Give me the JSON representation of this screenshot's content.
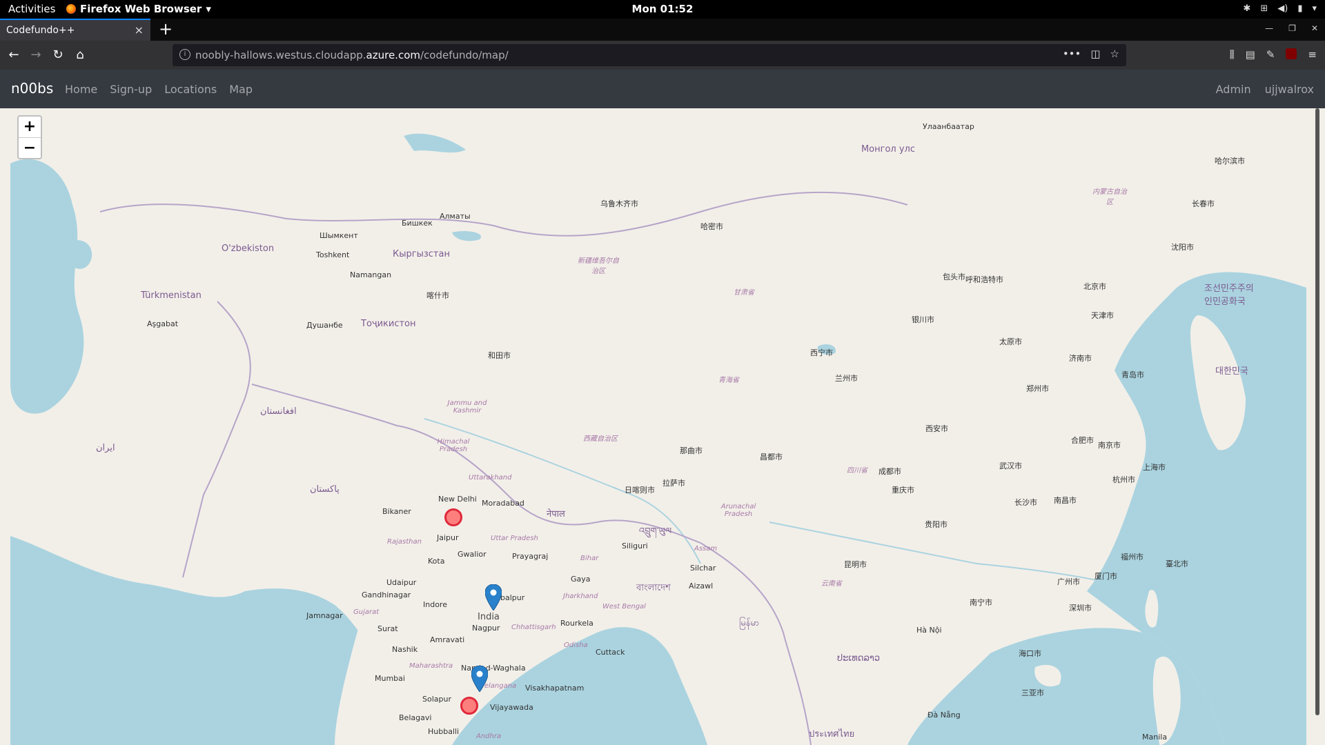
{
  "os_panel": {
    "activities": "Activities",
    "app_name": "Firefox Web Browser",
    "clock": "Mon 01:52"
  },
  "browser": {
    "tab_title": "Codefundo++",
    "url_prefix": "noobly-hallows.westus.cloudapp.",
    "url_host": "azure.com",
    "url_path": "/codefundo/map/"
  },
  "site_nav": {
    "brand": "n00bs",
    "links": [
      "Home",
      "Sign-up",
      "Locations",
      "Map"
    ],
    "right_links": [
      "Admin",
      "ujjwalrox"
    ]
  },
  "map": {
    "zoom_in": "+",
    "zoom_out": "−",
    "labels": {
      "new_delhi": "New Delhi",
      "moradabad": "Moradabad",
      "jaipur": "Jaipur",
      "bikaner": "Bikaner",
      "gwalior": "Gwalior",
      "kota": "Kota",
      "prayagraj": "Prayagraj",
      "udaipur": "Udaipur",
      "gandhinagar": "Gandhinagar",
      "indore": "Indore",
      "jabalpur": "Jabalpur",
      "india": "India",
      "nagpur": "Nagpur",
      "surat": "Surat",
      "amravati": "Amravati",
      "nashik": "Nashik",
      "mumbai": "Mumbai",
      "nanded": "Nanded-Waghala",
      "solapur": "Solapur",
      "vijayawada": "Vijayawada",
      "visakhapatnam": "Visakhapatnam",
      "belagavi": "Belagavi",
      "hubballi": "Hubballi",
      "cuttack": "Cuttack",
      "rourkela": "Rourkela",
      "gaya": "Gaya",
      "siliguri": "Siliguri",
      "silchar": "Silchar",
      "aizawl": "Aizawl",
      "jamnagar": "Jamnagar",
      "da_nang": "Đà Nẵng",
      "ha_noi": "Hà Nội",
      "manila": "Manila",
      "mongol": "Монгол улс",
      "ulaanbaatar": "Улаанбаатар",
      "bishkek": "Бишкек",
      "almaty": "Алматы",
      "tashkent": "Toshkent",
      "uzbekistan": "O'zbekiston",
      "turkmenistan": "Türkmenistan",
      "kyrgyzstan": "Кыргызстан",
      "tajikistan": "Тоҷикистон",
      "dushanbe": "Душанбе",
      "shymkent": "Шымкент",
      "namangan": "Namangan",
      "ashgabat": "Aşgabat",
      "urumqi": "乌鲁木齐市",
      "hami": "哈密市",
      "kashgar": "喀什市",
      "hotan": "和田市",
      "lhasa": "拉萨市",
      "shigatse": "日喀则市",
      "nagqu": "那曲市",
      "qamdo": "昌都市",
      "chengdu": "成都市",
      "chongqing": "重庆市",
      "wuhan": "武汉市",
      "beijing": "北京市",
      "tianjin": "天津市",
      "shanghai": "上海市",
      "xian": "西安市",
      "lanzhou": "兰州市",
      "xining": "西宁市",
      "kunming": "昆明市",
      "guiyang": "贵阳市",
      "nanning": "南宁市",
      "guangzhou": "广州市",
      "hangzhou": "杭州市",
      "nanjing": "南京市",
      "qingdao": "青岛市",
      "shenyang": "沈阳市",
      "changchun": "长春市",
      "harbin": "哈尔滨市",
      "hohhot": "呼和浩特市",
      "baotou": "包头市",
      "yinchuan": "银川市",
      "zhengzhou": "郑州市",
      "taiyuan": "太原市",
      "jinan": "济南市",
      "hefei": "合肥市",
      "nanchang": "南昌市",
      "changsha": "长沙市",
      "fuzhou": "福州市",
      "xiamen": "厦门市",
      "shenzhen": "深圳市",
      "taipei": "臺北市",
      "haikou": "海口市",
      "sanya": "三亚市",
      "korea": "대한민국",
      "dprk": "조선민주주의인민공화국",
      "pakistan": "پاکستان",
      "afghanistan": "افغانستان",
      "iran": "ایران",
      "nepal": "नेपाल",
      "bangladesh": "বাংলাদেশ",
      "myanmar": "မြန်မာ",
      "thailand": "ประเทศไทย",
      "laos": "ປະເທດລາວ",
      "bhutan": "འབྲུག་ཡུལ",
      "xinjiang": "新疆维吾尔自治区",
      "tibet": "西藏自治区",
      "qinghai": "青海省",
      "gansu": "甘肃省",
      "inner_mongolia": "内蒙古自治区",
      "sichuan": "四川省",
      "yunnan": "云南省",
      "rajasthan": "Rajasthan",
      "uttar_pradesh": "Uttar Pradesh",
      "maharashtra": "Maharashtra",
      "telangana": "Telangana",
      "chhattisgarh": "Chhattisgarh",
      "jharkhand": "Jharkhand",
      "odisha": "Odisha",
      "west_bengal": "West Bengal",
      "bihar": "Bihar",
      "assam": "Assam",
      "arunachal": "Arunachal Pradesh",
      "uttarakhand": "Uttarakhand",
      "himachal": "Himachal Pradesh",
      "jammu": "Jammu and Kashmir",
      "gujarat": "Gujarat",
      "andhra": "Andhra"
    }
  }
}
